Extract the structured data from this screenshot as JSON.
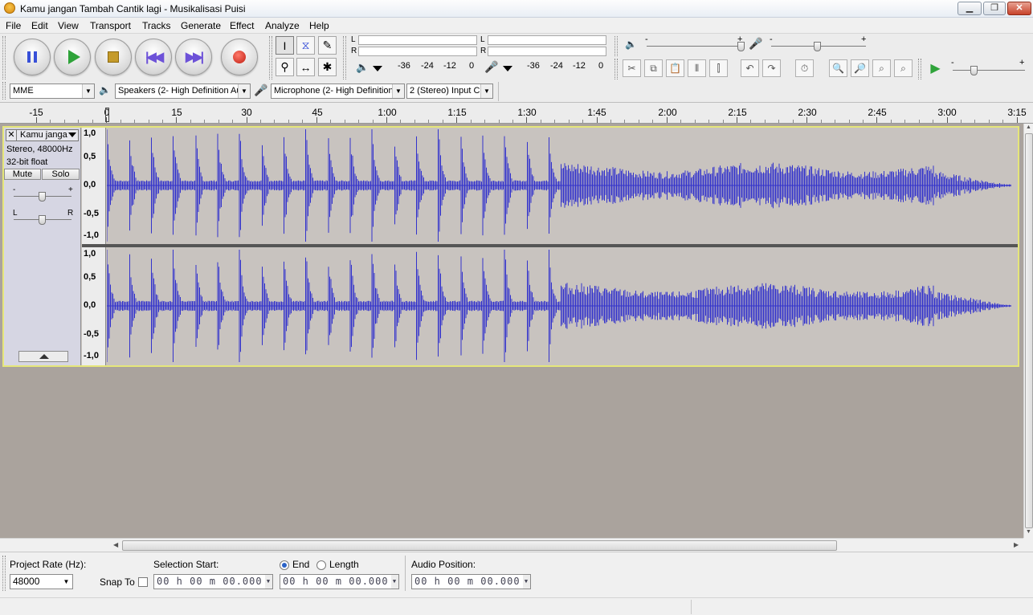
{
  "window": {
    "title": "Kamu jangan Tambah Cantik lagi - Musikalisasi Puisi"
  },
  "menu": [
    "File",
    "Edit",
    "View",
    "Transport",
    "Tracks",
    "Generate",
    "Effect",
    "Analyze",
    "Help"
  ],
  "meters": {
    "playback_L": "L",
    "playback_R": "R",
    "record_L": "L",
    "record_R": "R",
    "scale": [
      "-36",
      "-24",
      "-12",
      "0"
    ],
    "scale2": [
      "-36",
      "-24",
      "-12",
      "0"
    ]
  },
  "mixer": {
    "minus": "-",
    "plus": "+"
  },
  "device": {
    "host": "MME",
    "speakers": "Speakers (2- High Definition Au",
    "microphone": "Microphone (2- High Definition",
    "channels": "2 (Stereo) Input C"
  },
  "timeline": {
    "labels": [
      "-15",
      "0",
      "15",
      "30",
      "45",
      "1:00",
      "1:15",
      "1:30",
      "1:45",
      "2:00",
      "2:15",
      "2:30",
      "2:45",
      "3:00",
      "3:15"
    ]
  },
  "track": {
    "name": "Kamu janga",
    "format": "Stereo, 48000Hz",
    "bitdepth": "32-bit float",
    "mute": "Mute",
    "solo": "Solo",
    "gain_minus": "-",
    "gain_plus": "+",
    "pan_left": "L",
    "pan_right": "R",
    "vlabels": [
      "1,0",
      "0,5",
      "0,0",
      "-0,5",
      "-1,0"
    ],
    "wave_color": "#3333cc"
  },
  "selection": {
    "project_rate_label": "Project Rate (Hz):",
    "project_rate": "48000",
    "snap_to": "Snap To",
    "selection_start_label": "Selection Start:",
    "end_label": "End",
    "length_label": "Length",
    "audio_position_label": "Audio Position:",
    "start_time": "00 h 00 m 00.000 s",
    "end_time": "00 h 00 m 00.000 s",
    "audio_time": "00 h 00 m 00.000 s"
  }
}
